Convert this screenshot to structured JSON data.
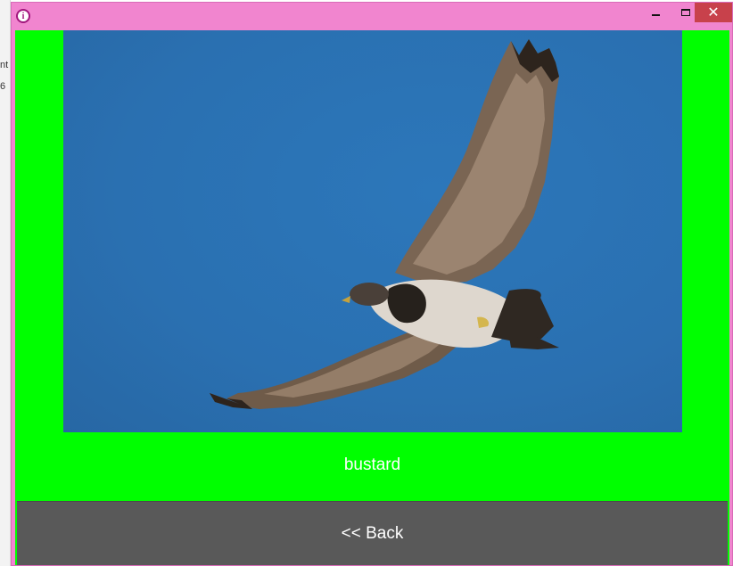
{
  "window": {
    "close_glyph": "✕"
  },
  "bird_label": "bustard",
  "back_button": {
    "label": "<< Back"
  },
  "background_fragments": [
    "nt",
    "6"
  ],
  "colors": {
    "titlebar": "#f185cf",
    "client_background": "#00ff00",
    "button_background": "#595959",
    "close_button": "#c8414b",
    "sky": "#2a70b1"
  },
  "icons": {
    "app_icon": "info-icon",
    "minimize": "minimize-icon",
    "maximize": "maximize-icon",
    "close": "close-icon"
  }
}
